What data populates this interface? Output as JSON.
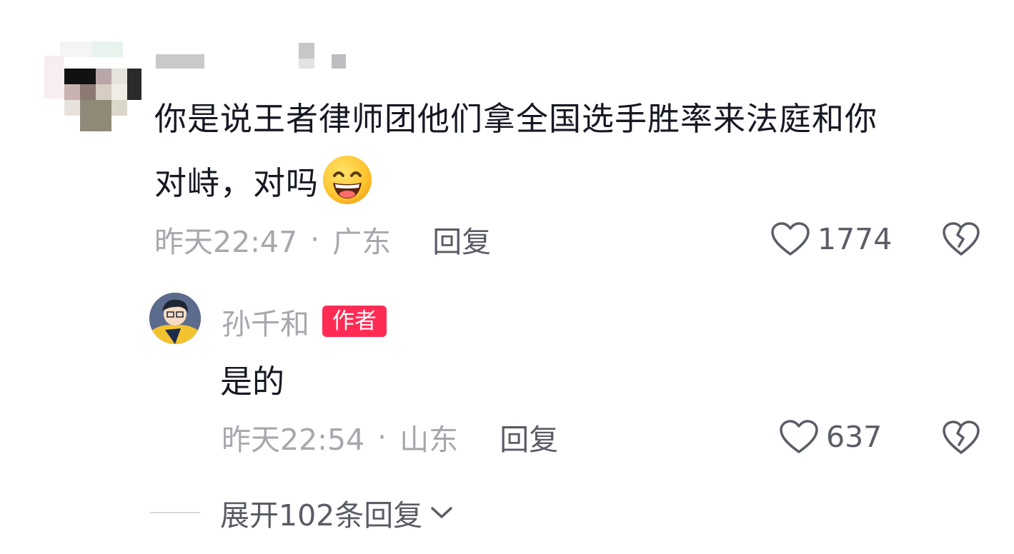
{
  "comment": {
    "text_line1": "你是说王者律师团他们拿全国选手胜率来法庭和你",
    "text_line2": "对峙，对吗",
    "emoji": "grinning-smiling-eyes-emoji",
    "time": "昨天22:47",
    "separator": "·",
    "location": "广东",
    "reply_label": "回复",
    "like_count": "1774",
    "like_icon": "heart-outline-icon",
    "dislike_icon": "broken-heart-icon"
  },
  "reply": {
    "username": "孙千和",
    "badge": "作者",
    "text": "是的",
    "time": "昨天22:54",
    "separator": "·",
    "location": "山东",
    "reply_label": "回复",
    "like_count": "637",
    "like_icon": "heart-outline-icon",
    "dislike_icon": "broken-heart-icon"
  },
  "expand": {
    "label": "展开102条回复",
    "icon": "chevron-down-icon"
  },
  "colors": {
    "text_primary": "#161823",
    "text_secondary": "#a6a8ae",
    "text_action": "#5a5c66",
    "badge_bg": "#fe2c55"
  }
}
